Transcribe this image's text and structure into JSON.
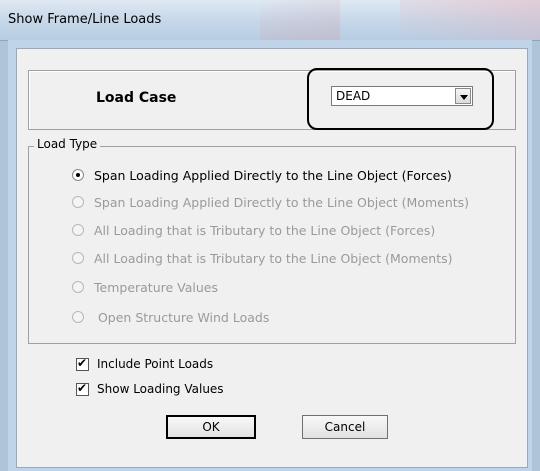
{
  "window": {
    "title": "Show Frame/Line Loads"
  },
  "load_case": {
    "label": "Load Case",
    "selected": "DEAD"
  },
  "load_type": {
    "legend": "Load Type",
    "options": [
      {
        "label": "Span Loading Applied Directly to the Line Object (Forces)",
        "selected": true,
        "enabled": true
      },
      {
        "label": "Span Loading Applied Directly to the Line Object (Moments)",
        "selected": false,
        "enabled": false
      },
      {
        "label": "All Loading that is Tributary to the Line Object (Forces)",
        "selected": false,
        "enabled": false
      },
      {
        "label": "All Loading that is Tributary to the Line Object (Moments)",
        "selected": false,
        "enabled": false
      },
      {
        "label": "Temperature Values",
        "selected": false,
        "enabled": false
      },
      {
        "label": " Open Structure Wind Loads",
        "selected": false,
        "enabled": false
      }
    ]
  },
  "options": {
    "include_point_loads": {
      "label": "Include Point Loads",
      "checked": true
    },
    "show_loading_values": {
      "label": "Show Loading Values",
      "checked": true
    }
  },
  "buttons": {
    "ok": "OK",
    "cancel": "Cancel"
  }
}
